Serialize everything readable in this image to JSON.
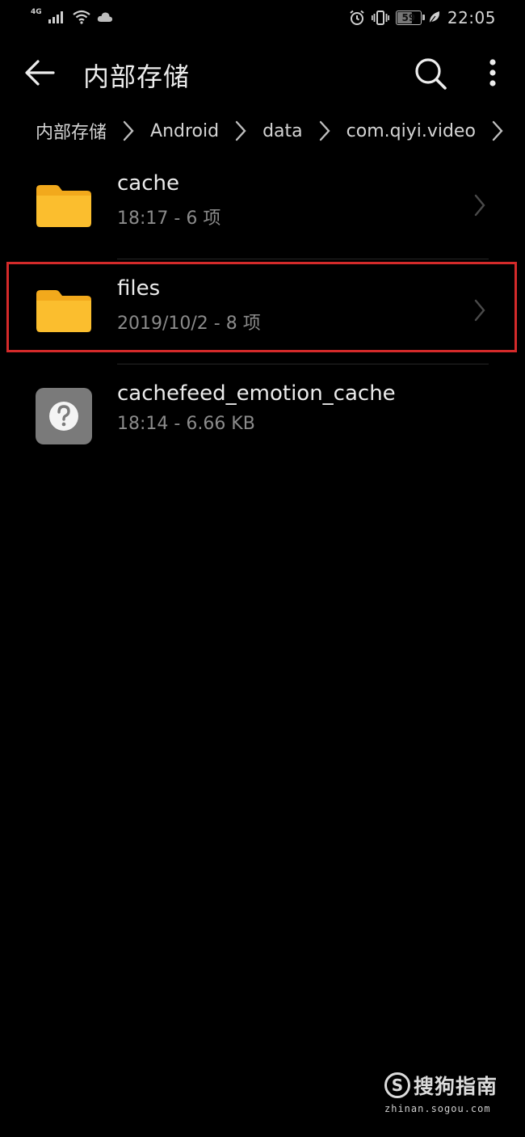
{
  "status_bar": {
    "network": "4G",
    "battery_level": "59",
    "battery_fraction": 0.59,
    "time": "22:05",
    "icons": [
      "signal-icon",
      "wifi-icon",
      "cloud-icon",
      "alarm-icon",
      "vibrate-icon",
      "battery-icon",
      "leaf-icon"
    ]
  },
  "toolbar": {
    "title": "内部存储"
  },
  "breadcrumb": {
    "items": [
      "内部存储",
      "Android",
      "data",
      "com.qiyi.video"
    ]
  },
  "files": [
    {
      "name": "cache",
      "meta": "18:17 - 6 项",
      "type": "folder"
    },
    {
      "name": "files",
      "meta": "2019/10/2 - 8 项",
      "type": "folder",
      "highlighted": true
    },
    {
      "name": "cachefeed_emotion_cache",
      "meta": "18:14 - 6.66 KB",
      "type": "unknown-file"
    }
  ],
  "colors": {
    "folder": "#FBBE2E",
    "folder_tab": "#F2A91C",
    "highlight": "#d42a2a",
    "unknown_file": "#7a7a7a"
  },
  "watermark": {
    "logo_letter": "S",
    "brand": "搜狗指南",
    "url": "zhinan.sogou.com"
  }
}
